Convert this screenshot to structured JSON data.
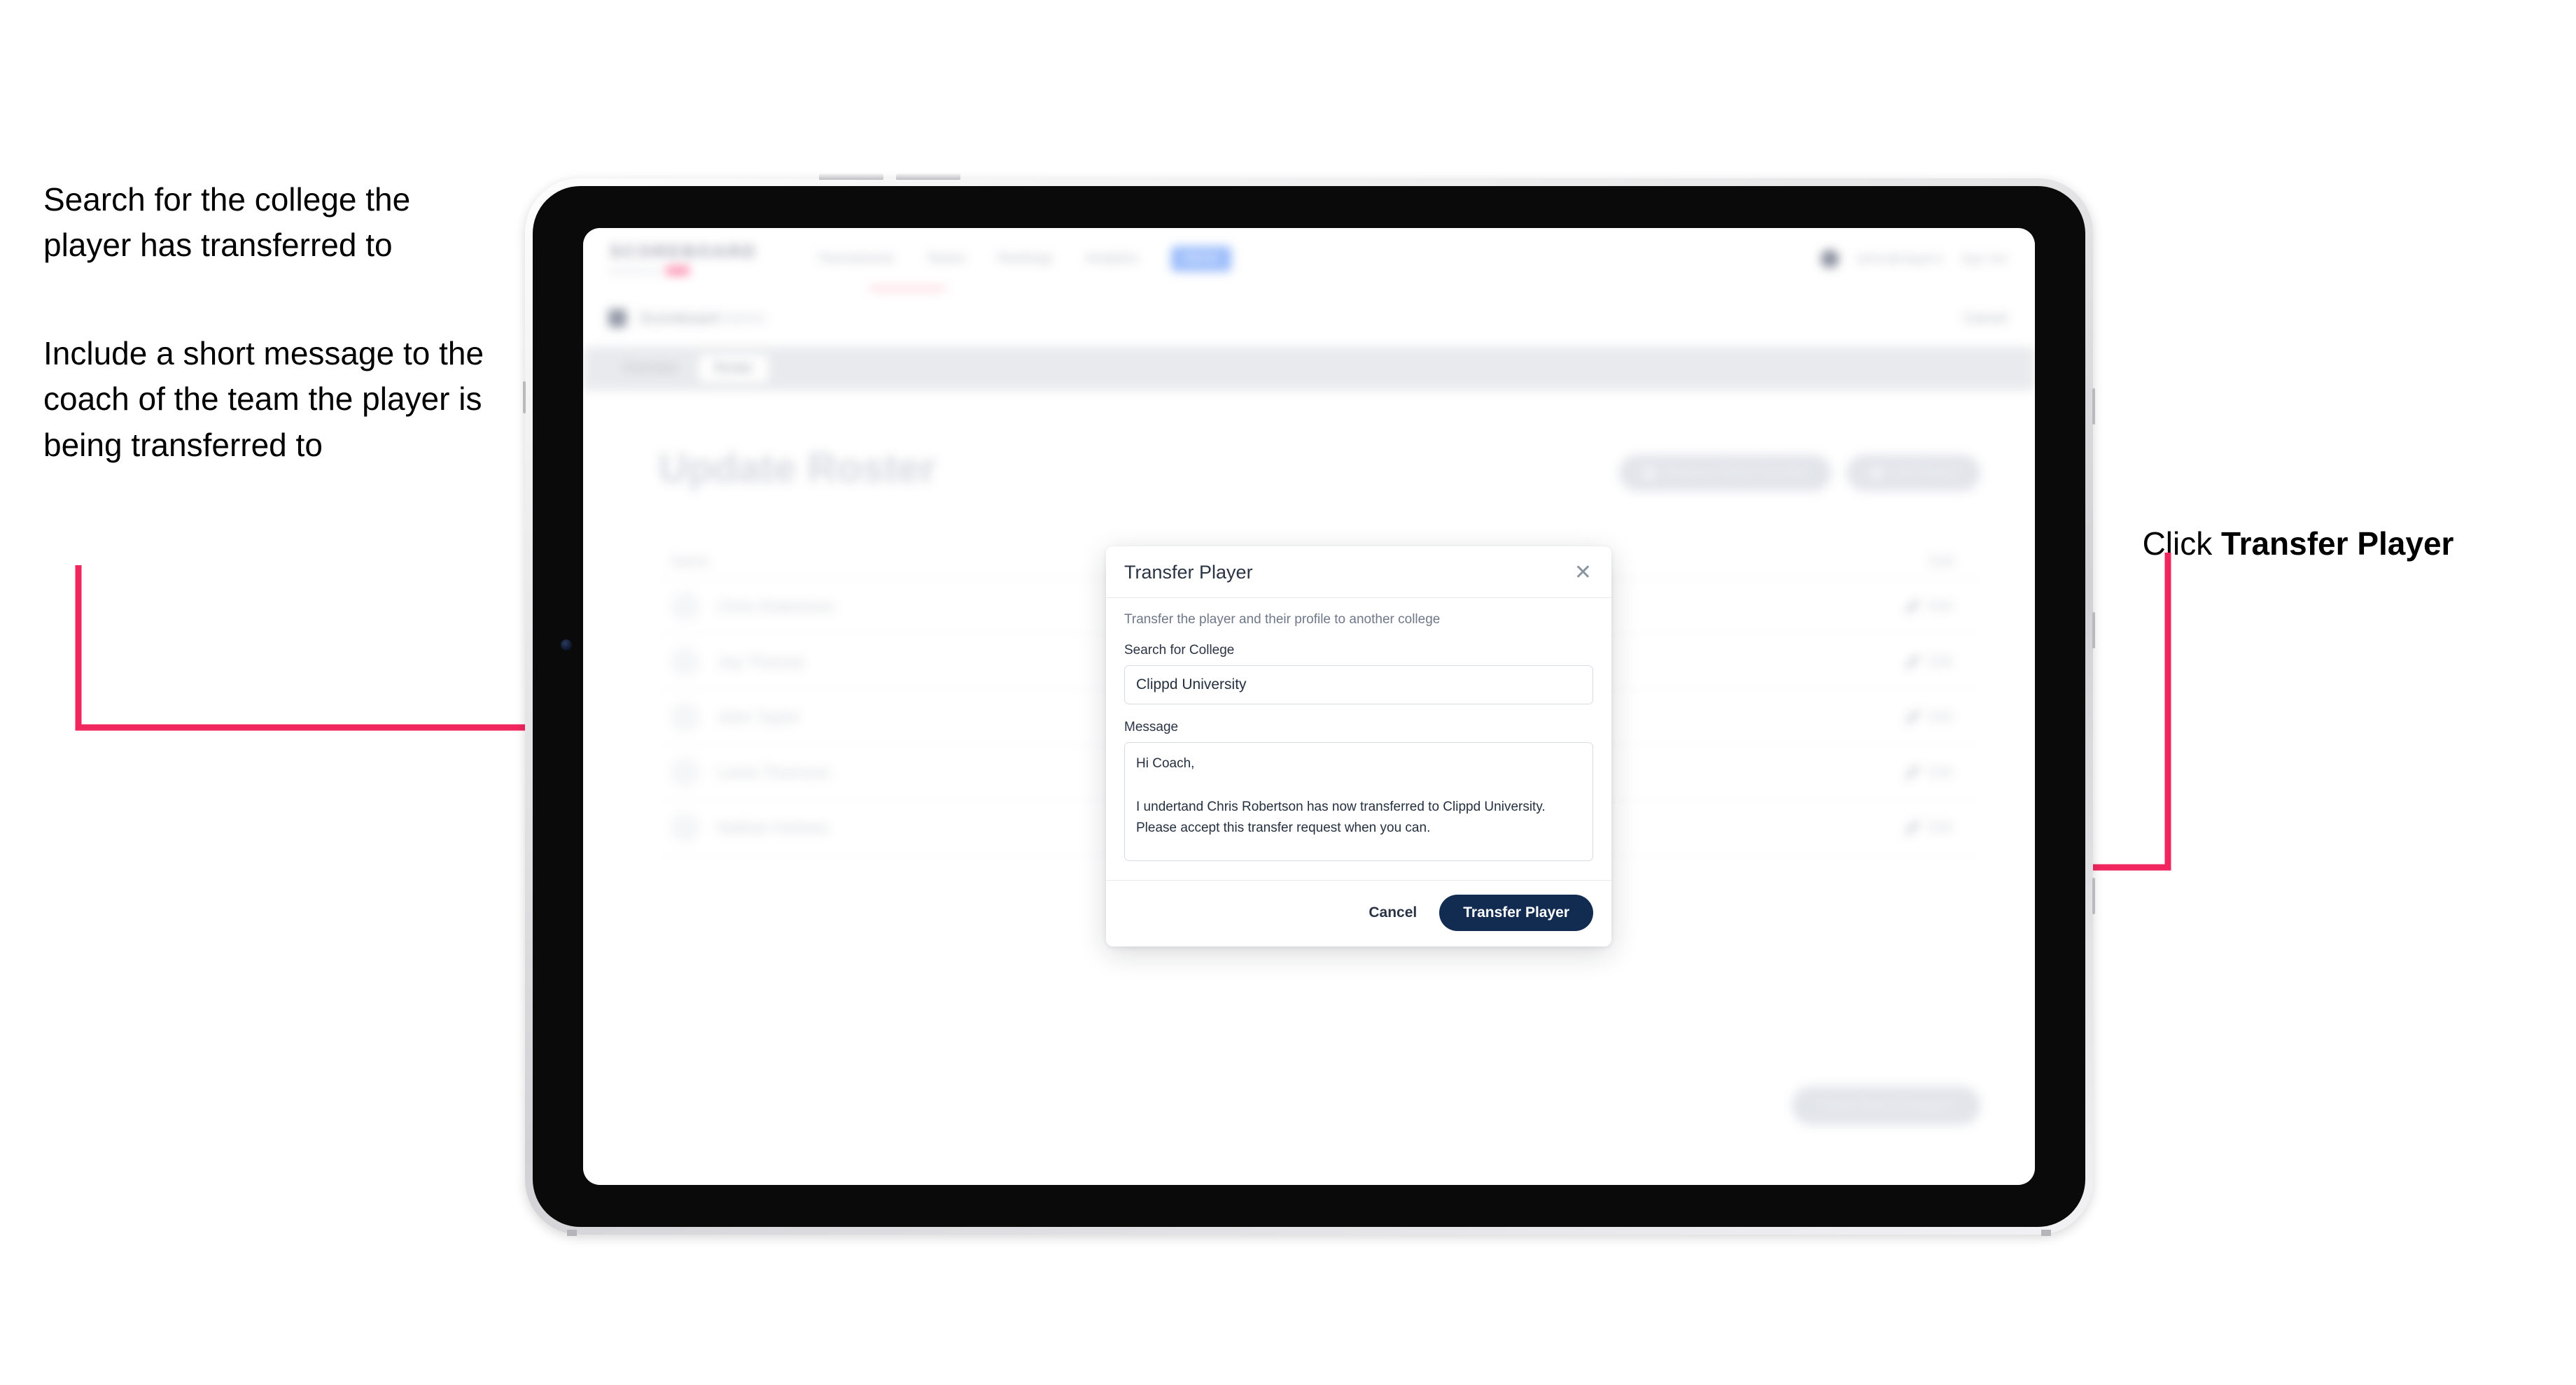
{
  "annotations": {
    "left_1": "Search for the college the player has transferred to",
    "left_2": "Include a short message to the coach of the team the player is being transferred to",
    "right_prefix": "Click ",
    "right_strong": "Transfer Player"
  },
  "colors": {
    "accent_pink": "#F2265F",
    "primary_navy": "#112B51",
    "nav_pill_blue": "#4A86F7",
    "brand_pink": "#FB2F6A"
  },
  "app": {
    "brand": {
      "word": "SCOREBOARD",
      "sub": "powered by"
    },
    "nav_links": [
      "Tournaments",
      "Teams",
      "Rankings",
      "Analytics"
    ],
    "nav_pill": "Admin",
    "nav_right": {
      "user": "admin@clippd.io",
      "menu": "Sign Out"
    },
    "breadcrumb": {
      "label": "Scoreboard",
      "sub": "Admin",
      "right_action": "Cancel"
    },
    "tabs": [
      {
        "label": "Overview",
        "active": false
      },
      {
        "label": "Roster",
        "active": true
      }
    ],
    "page_title": "Update Roster",
    "header_actions": [
      {
        "label": "Request Player Transfer",
        "icon": "transfer-icon"
      },
      {
        "label": "Add Player",
        "icon": "plus-icon"
      }
    ],
    "roster": {
      "col_name": "Name",
      "col_edit": "Edit",
      "rows": [
        {
          "name": "Chris Robertson",
          "edit": "Edit"
        },
        {
          "name": "Jay Thomas",
          "edit": "Edit"
        },
        {
          "name": "John Taylor",
          "edit": "Edit"
        },
        {
          "name": "Lewis Thomson",
          "edit": "Edit"
        },
        {
          "name": "Nathan Holmes",
          "edit": "Edit"
        }
      ]
    },
    "save_button": "Save Team Changes"
  },
  "modal": {
    "title": "Transfer Player",
    "close_icon": "close-icon",
    "subtitle": "Transfer the player and their profile to another college",
    "college_label": "Search for College",
    "college_value": "Clippd University",
    "college_placeholder": "Search for College",
    "message_label": "Message",
    "message_value": "Hi Coach,\n\nI undertand Chris Robertson has now transferred to Clippd University. Please accept this transfer request when you can.",
    "message_placeholder": "Message",
    "cancel_label": "Cancel",
    "submit_label": "Transfer Player"
  }
}
